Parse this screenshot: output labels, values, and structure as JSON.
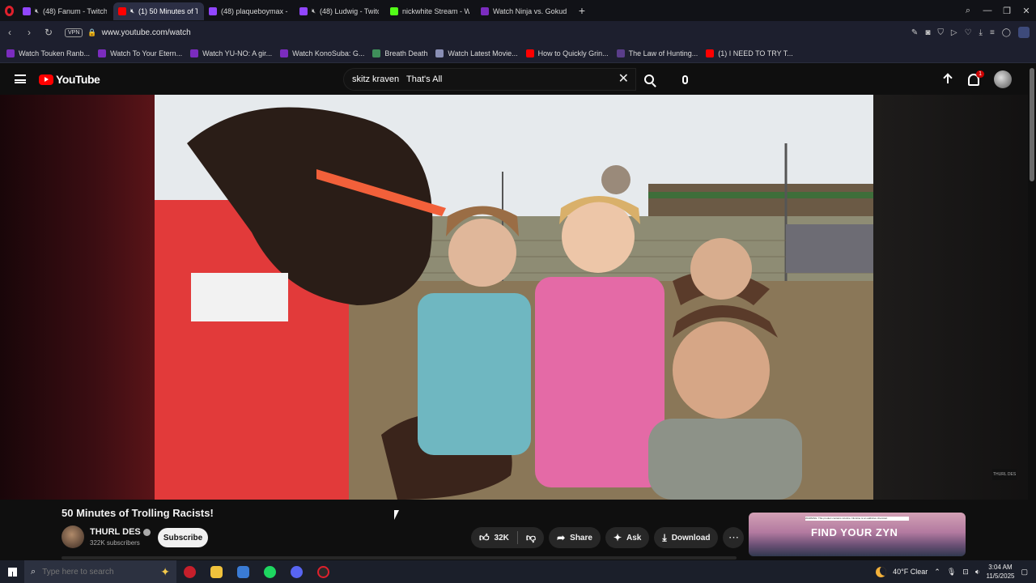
{
  "browser": {
    "tabs": [
      {
        "label": "(48) Fanum - Twitch",
        "muted": true,
        "color": "#9146ff",
        "active": false
      },
      {
        "label": "(1) 50 Minutes of Troll",
        "muted": true,
        "color": "#ff0000",
        "active": true
      },
      {
        "label": "(48) plaqueboymax - Twit",
        "muted": false,
        "color": "#9146ff",
        "active": false
      },
      {
        "label": "(48) Ludwig - Twitch",
        "muted": true,
        "color": "#9146ff",
        "active": false
      },
      {
        "label": "nickwhite Stream - Watch",
        "muted": false,
        "color": "#53fc18",
        "active": false
      },
      {
        "label": "Watch Ninja vs. Gokudo o",
        "muted": false,
        "color": "#7b2cbf",
        "active": false
      }
    ],
    "new_tab_icon": "plus-icon",
    "vpn_label": "VPN",
    "url": "www.youtube.com/watch",
    "bookmarks": [
      {
        "label": "Watch Touken Ranb...",
        "color": "#7b2cbf"
      },
      {
        "label": "Watch To Your Etern...",
        "color": "#7b2cbf"
      },
      {
        "label": "Watch YU-NO: A gir...",
        "color": "#7b2cbf"
      },
      {
        "label": "Watch KonoSuba: G...",
        "color": "#7b2cbf"
      },
      {
        "label": "Breath Death",
        "color": "#3f8f5a"
      },
      {
        "label": "Watch Latest Movie...",
        "color": "#8a8fb5"
      },
      {
        "label": "How to Quickly Grin...",
        "color": "#ff0000"
      },
      {
        "label": "The Law of Hunting...",
        "color": "#5a3d8a"
      },
      {
        "label": "(1) I NEED TO TRY T...",
        "color": "#ff0000"
      }
    ]
  },
  "youtube": {
    "logo_text": "YouTube",
    "search": {
      "value": "skitz kraven   That's All"
    },
    "notification_count": "1"
  },
  "video": {
    "title": "50 Minutes of Trolling Racists!",
    "watermark": "THURL DES",
    "channel": {
      "name": "THURL DES",
      "subscribers": "322K subscribers"
    },
    "subscribe_label": "Subscribe",
    "likes": "32K",
    "share_label": "Share",
    "ask_label": "Ask",
    "download_label": "Download",
    "ad": {
      "headline": "FIND YOUR ZYN",
      "fine_print": "WARNING: This product contains nicotine. Nicotine is an addictive chemical."
    }
  },
  "taskbar": {
    "search_placeholder": "Type here to search",
    "weather": "40°F  Clear",
    "time": "3:04 AM",
    "date": "11/5/2025"
  }
}
